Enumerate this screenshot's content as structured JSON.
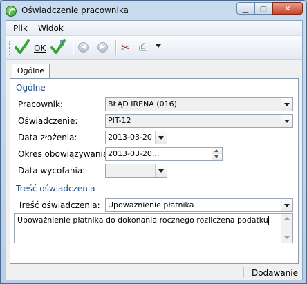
{
  "window": {
    "title": "Oświadczenie pracownika"
  },
  "menu": {
    "items": [
      {
        "label": "Plik",
        "key": "P"
      },
      {
        "label": "Widok",
        "key": "W"
      }
    ]
  },
  "toolbar": {
    "ok_label": "OK"
  },
  "tabs": [
    {
      "label": "Ogólne"
    }
  ],
  "section_general": {
    "title": "Ogólne"
  },
  "fields": {
    "pracownik": {
      "label": "Pracownik:",
      "value": "BŁĄD IRENA (016)"
    },
    "oswiadczenie": {
      "label": "Oświadczenie:",
      "value": "PIT-12"
    },
    "data_zlozenia": {
      "label": "Data złożenia:",
      "value": "2013-03-20"
    },
    "okres": {
      "label": "Okres obowiązywania:",
      "value": "2013-03-20..."
    },
    "data_wycofania": {
      "label": "Data wycofania:",
      "value": ""
    }
  },
  "section_content": {
    "title": "Treść oświadczenia"
  },
  "tresc": {
    "label": "Treść oświadczenia:",
    "value": "Upoważnienie płatnika"
  },
  "memo": {
    "text": "Upoważnienie płatnika do dokonania rocznego rozliczena podatku"
  },
  "status": {
    "mode": "Dodawanie"
  },
  "colors": {
    "accent": "#1f4e8c",
    "ok_green": "#3aa53a"
  }
}
